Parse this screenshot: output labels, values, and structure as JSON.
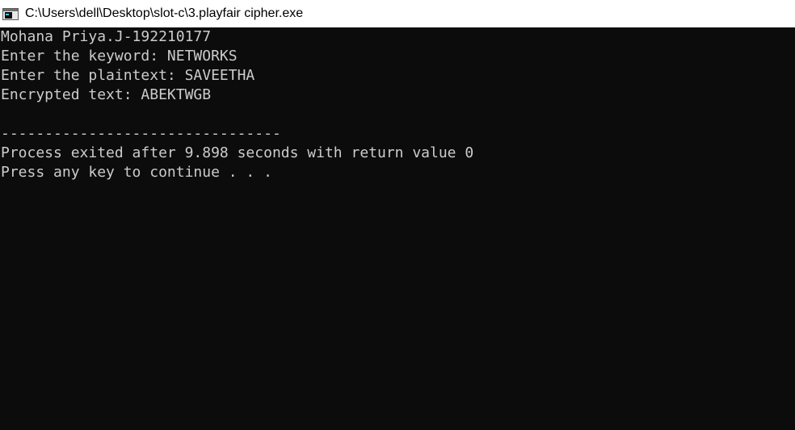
{
  "window": {
    "title": "C:\\Users\\dell\\Desktop\\slot-c\\3.playfair cipher.exe",
    "icon": "console-app-icon"
  },
  "console": {
    "lines": [
      "Mohana Priya.J-192210177",
      "Enter the keyword: NETWORKS",
      "Enter the plaintext: SAVEETHA",
      "Encrypted text: ABEKTWGB",
      "",
      "--------------------------------",
      "Process exited after 9.898 seconds with return value 0",
      "Press any key to continue . . ."
    ]
  },
  "colors": {
    "background": "#0c0c0c",
    "text": "#cccccc",
    "titlebar": "#ffffff"
  }
}
